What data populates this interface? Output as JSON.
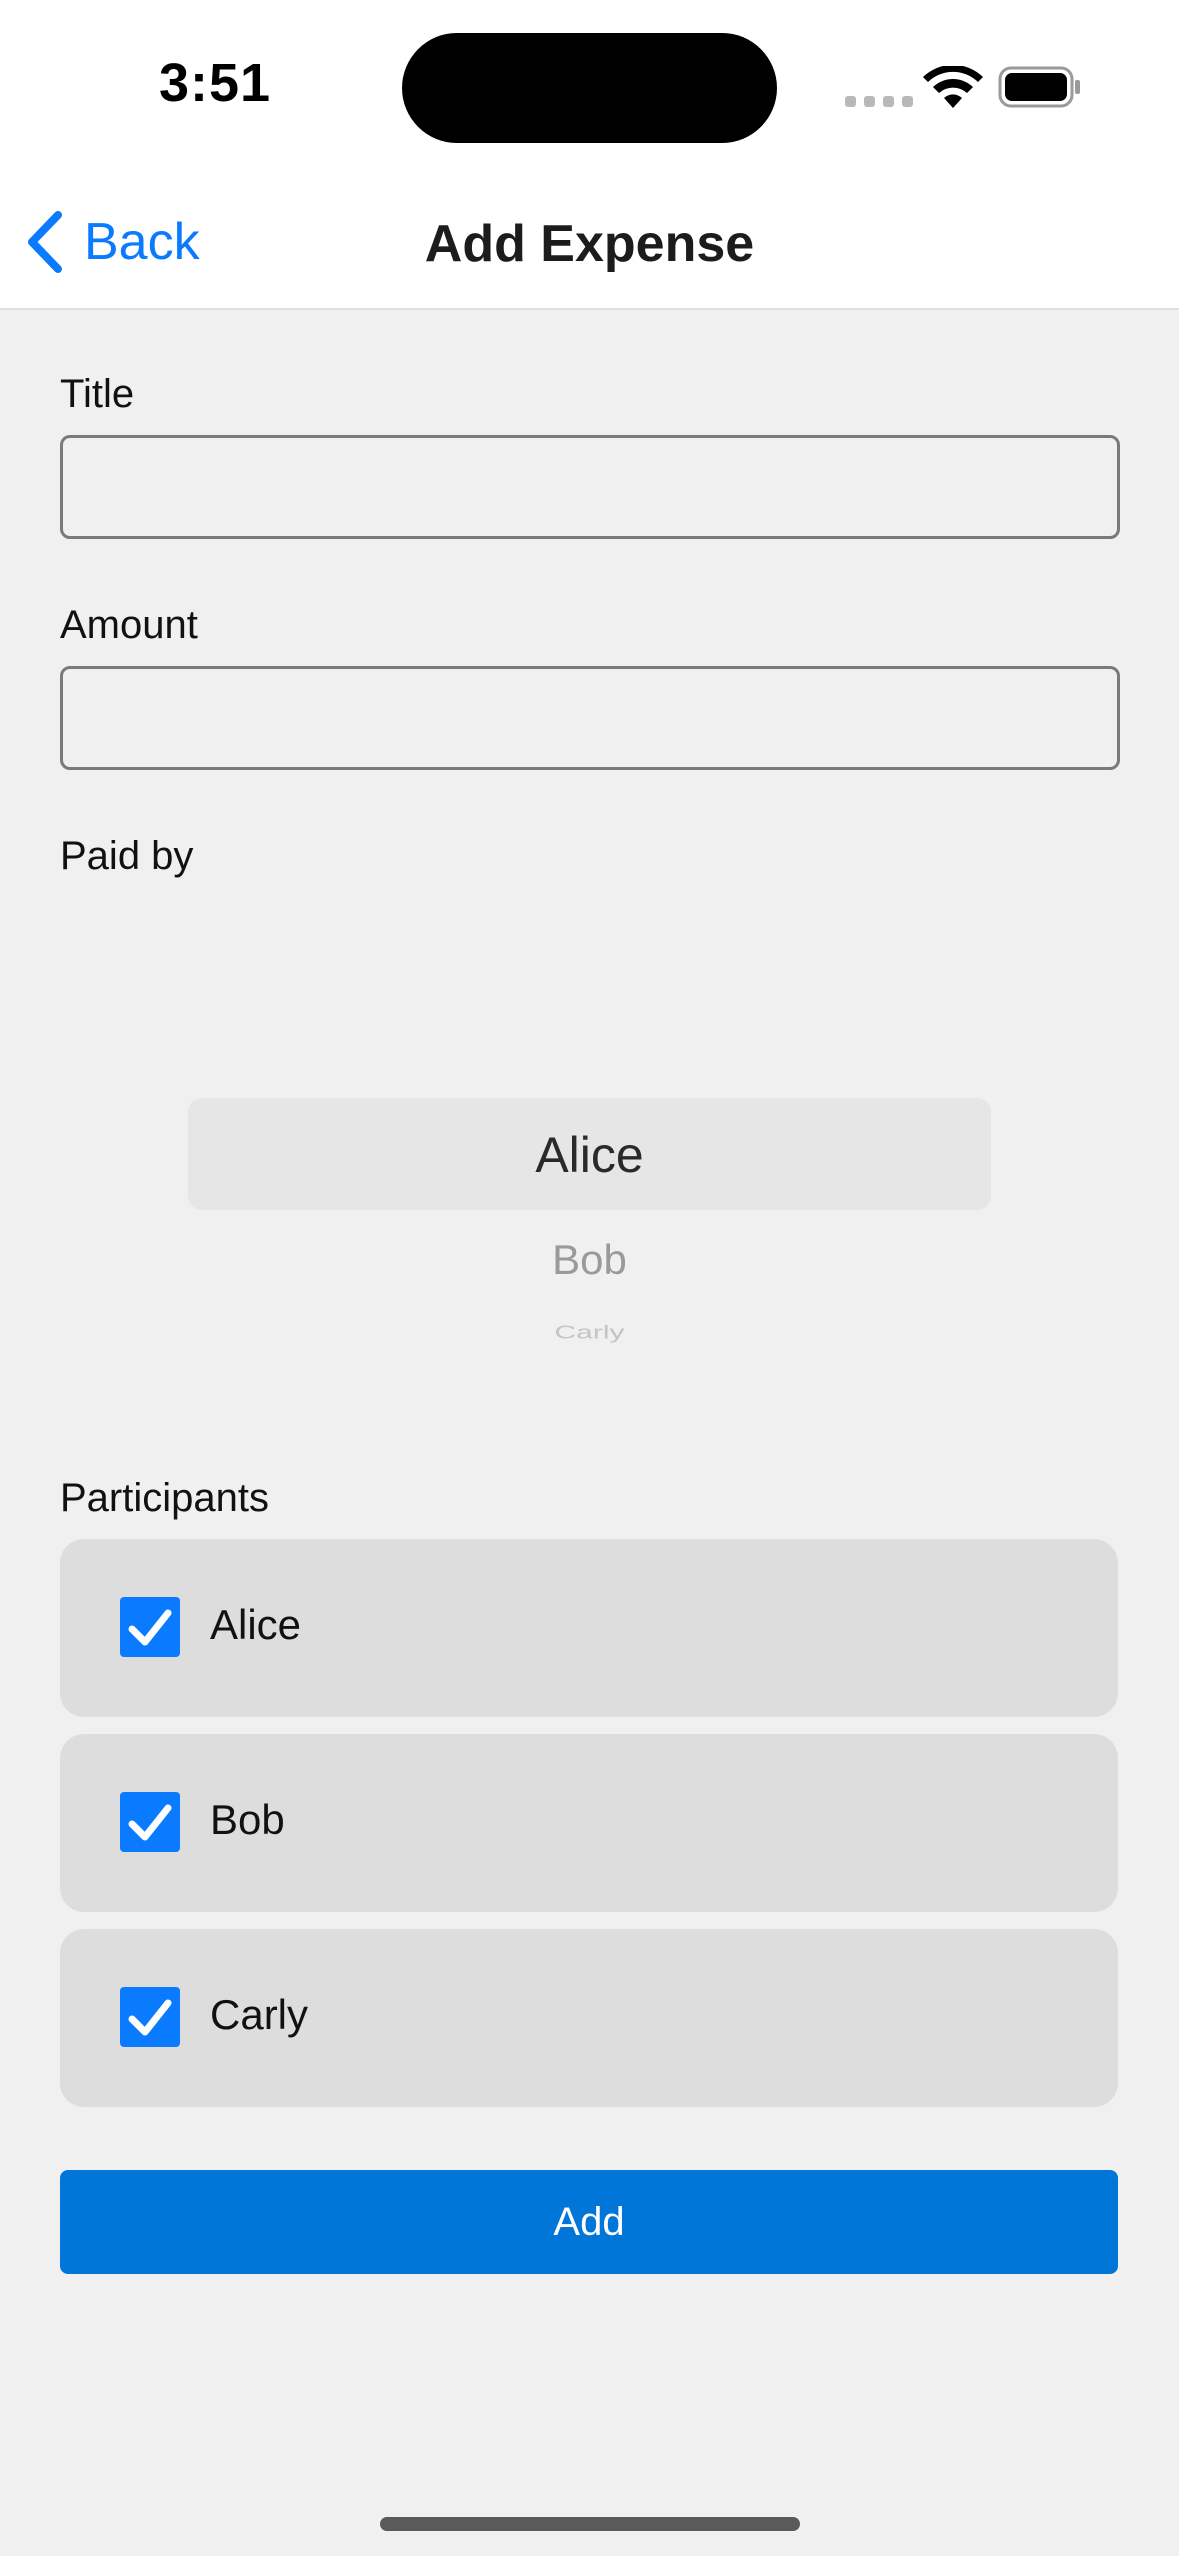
{
  "status": {
    "time": "3:51"
  },
  "nav": {
    "back_label": "Back",
    "title": "Add Expense"
  },
  "form": {
    "title_label": "Title",
    "title_value": "",
    "amount_label": "Amount",
    "amount_value": "",
    "paid_by_label": "Paid by",
    "paid_by_options": [
      "Alice",
      "Bob",
      "Carly"
    ],
    "paid_by_selected": "Alice",
    "participants_label": "Participants",
    "participants": [
      {
        "name": "Alice",
        "checked": true
      },
      {
        "name": "Bob",
        "checked": true
      },
      {
        "name": "Carly",
        "checked": true
      }
    ],
    "add_label": "Add"
  },
  "colors": {
    "accent": "#0a7aff",
    "button": "#0076d9",
    "background": "#f0f0f0"
  },
  "icons": {
    "back": "chevron-left-icon",
    "checkbox": "checkmark-icon",
    "wifi": "wifi-icon",
    "battery": "battery-icon"
  }
}
